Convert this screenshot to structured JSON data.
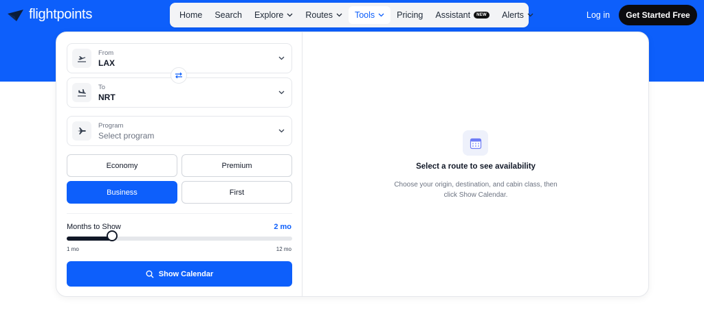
{
  "header": {
    "logo_text": "flightpoints",
    "nav": [
      {
        "label": "Home",
        "has_chevron": false
      },
      {
        "label": "Search",
        "has_chevron": false
      },
      {
        "label": "Explore",
        "has_chevron": true
      },
      {
        "label": "Routes",
        "has_chevron": true
      },
      {
        "label": "Tools",
        "has_chevron": true,
        "active": true
      },
      {
        "label": "Pricing",
        "has_chevron": false
      },
      {
        "label": "Assistant",
        "badge": "NEW",
        "has_chevron": false
      },
      {
        "label": "Alerts",
        "has_chevron": true
      }
    ],
    "login_label": "Log in",
    "cta_label": "Get Started Free"
  },
  "form": {
    "from": {
      "label": "From",
      "value": "LAX",
      "icon": "plane-departure-icon"
    },
    "to": {
      "label": "To",
      "value": "NRT",
      "icon": "plane-arrival-icon"
    },
    "program": {
      "label": "Program",
      "placeholder": "Select program",
      "icon": "plane-icon"
    },
    "swap_icon": "swap-icon",
    "cabins": [
      {
        "label": "Economy",
        "selected": false
      },
      {
        "label": "Premium",
        "selected": false
      },
      {
        "label": "Business",
        "selected": true
      },
      {
        "label": "First",
        "selected": false
      }
    ],
    "months": {
      "label": "Months to Show",
      "value_label": "2 mo",
      "value": 2,
      "min": 1,
      "max": 12,
      "min_label": "1 mo",
      "max_label": "12 mo"
    },
    "submit_label": "Show Calendar",
    "submit_icon": "search-icon"
  },
  "empty_state": {
    "icon": "calendar-icon",
    "title": "Select a route to see availability",
    "description": "Choose your origin, destination, and cabin class, then click Show Calendar."
  },
  "colors": {
    "brand_blue": "#0d5ffb",
    "dark": "#0b0b0f",
    "nav_bg": "#f3f4f6"
  }
}
